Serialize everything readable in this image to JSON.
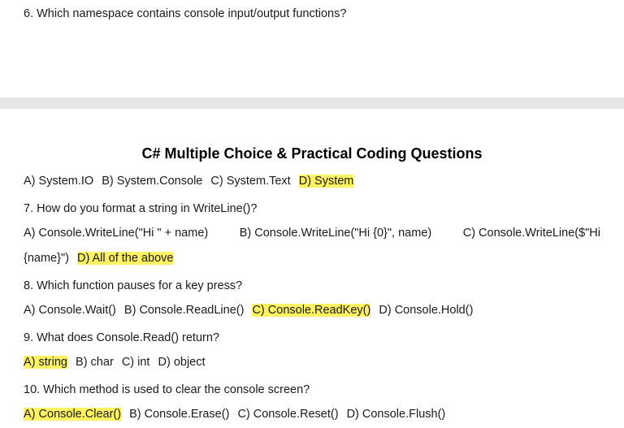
{
  "top_page": {
    "q6_text": "6. Which namespace contains console input/output functions?"
  },
  "bottom_page": {
    "header": "C# Multiple Choice & Practical Coding Questions",
    "q6_options": {
      "a": "A) System.IO",
      "b": "B) System.Console",
      "c": "C) System.Text",
      "d": "D) System"
    },
    "q7": {
      "question": "7. How do you format a string in WriteLine()?",
      "a": "A) Console.WriteLine(\"Hi \" + name)",
      "b": "B) Console.WriteLine(\"Hi {0}\", name)",
      "c": "C) Console.WriteLine($\"Hi",
      "c_cont": "{name}\")",
      "d": "D) All of the above"
    },
    "q8": {
      "question": "8. Which function pauses for a key press?",
      "a": "A) Console.Wait()",
      "b": "B) Console.ReadLine()",
      "c": "C) Console.ReadKey()",
      "d": "D) Console.Hold()"
    },
    "q9": {
      "question": "9. What does Console.Read() return?",
      "a": "A) string",
      "b": "B) char",
      "c": "C) int",
      "d": "D) object"
    },
    "q10": {
      "question": "10. Which method is used to clear the console screen?",
      "a": "A) Console.Clear()",
      "b": "B) Console.Erase()",
      "c": "C) Console.Reset()",
      "d": "D) Console.Flush()"
    }
  },
  "colors": {
    "highlight": "#fff263",
    "page_gap": "#e6e6e6"
  }
}
